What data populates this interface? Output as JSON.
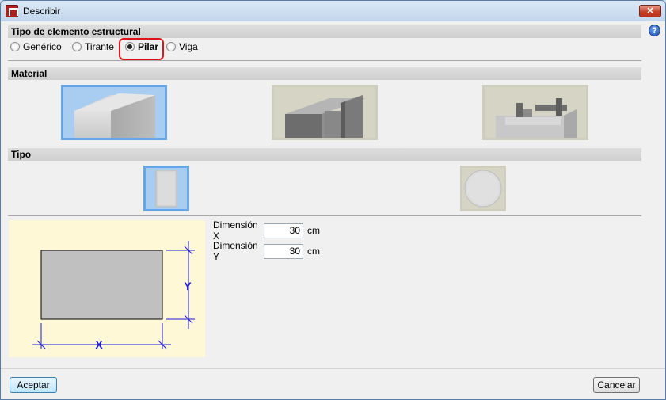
{
  "window": {
    "title": "Describir",
    "close_glyph": "✕"
  },
  "help_glyph": "?",
  "sections": {
    "tipo_elemento": "Tipo de elemento estructural",
    "material": "Material",
    "tipo": "Tipo"
  },
  "element_types": [
    {
      "label": "Genérico",
      "checked": false
    },
    {
      "label": "Tirante",
      "checked": false
    },
    {
      "label": "Pilar",
      "checked": true
    },
    {
      "label": "Viga",
      "checked": false
    }
  ],
  "materials": [
    {
      "icon": "concrete-block-icon",
      "selected": true
    },
    {
      "icon": "steel-section-icon",
      "selected": false
    },
    {
      "icon": "composite-section-icon",
      "selected": false
    }
  ],
  "tipos": [
    {
      "icon": "rectangular-section-icon",
      "selected": true
    },
    {
      "icon": "circular-section-icon",
      "selected": false
    }
  ],
  "diagram": {
    "x_label": "X",
    "y_label": "Y"
  },
  "dimensions": {
    "x": {
      "label": "Dimensión X",
      "value": "30",
      "unit": "cm"
    },
    "y": {
      "label": "Dimensión Y",
      "value": "30",
      "unit": "cm"
    }
  },
  "buttons": {
    "accept": "Aceptar",
    "cancel": "Cancelar"
  },
  "colors": {
    "selection_border": "#66a6e8",
    "highlight": "#e0131a",
    "dimension_lines": "#1a1adc"
  }
}
